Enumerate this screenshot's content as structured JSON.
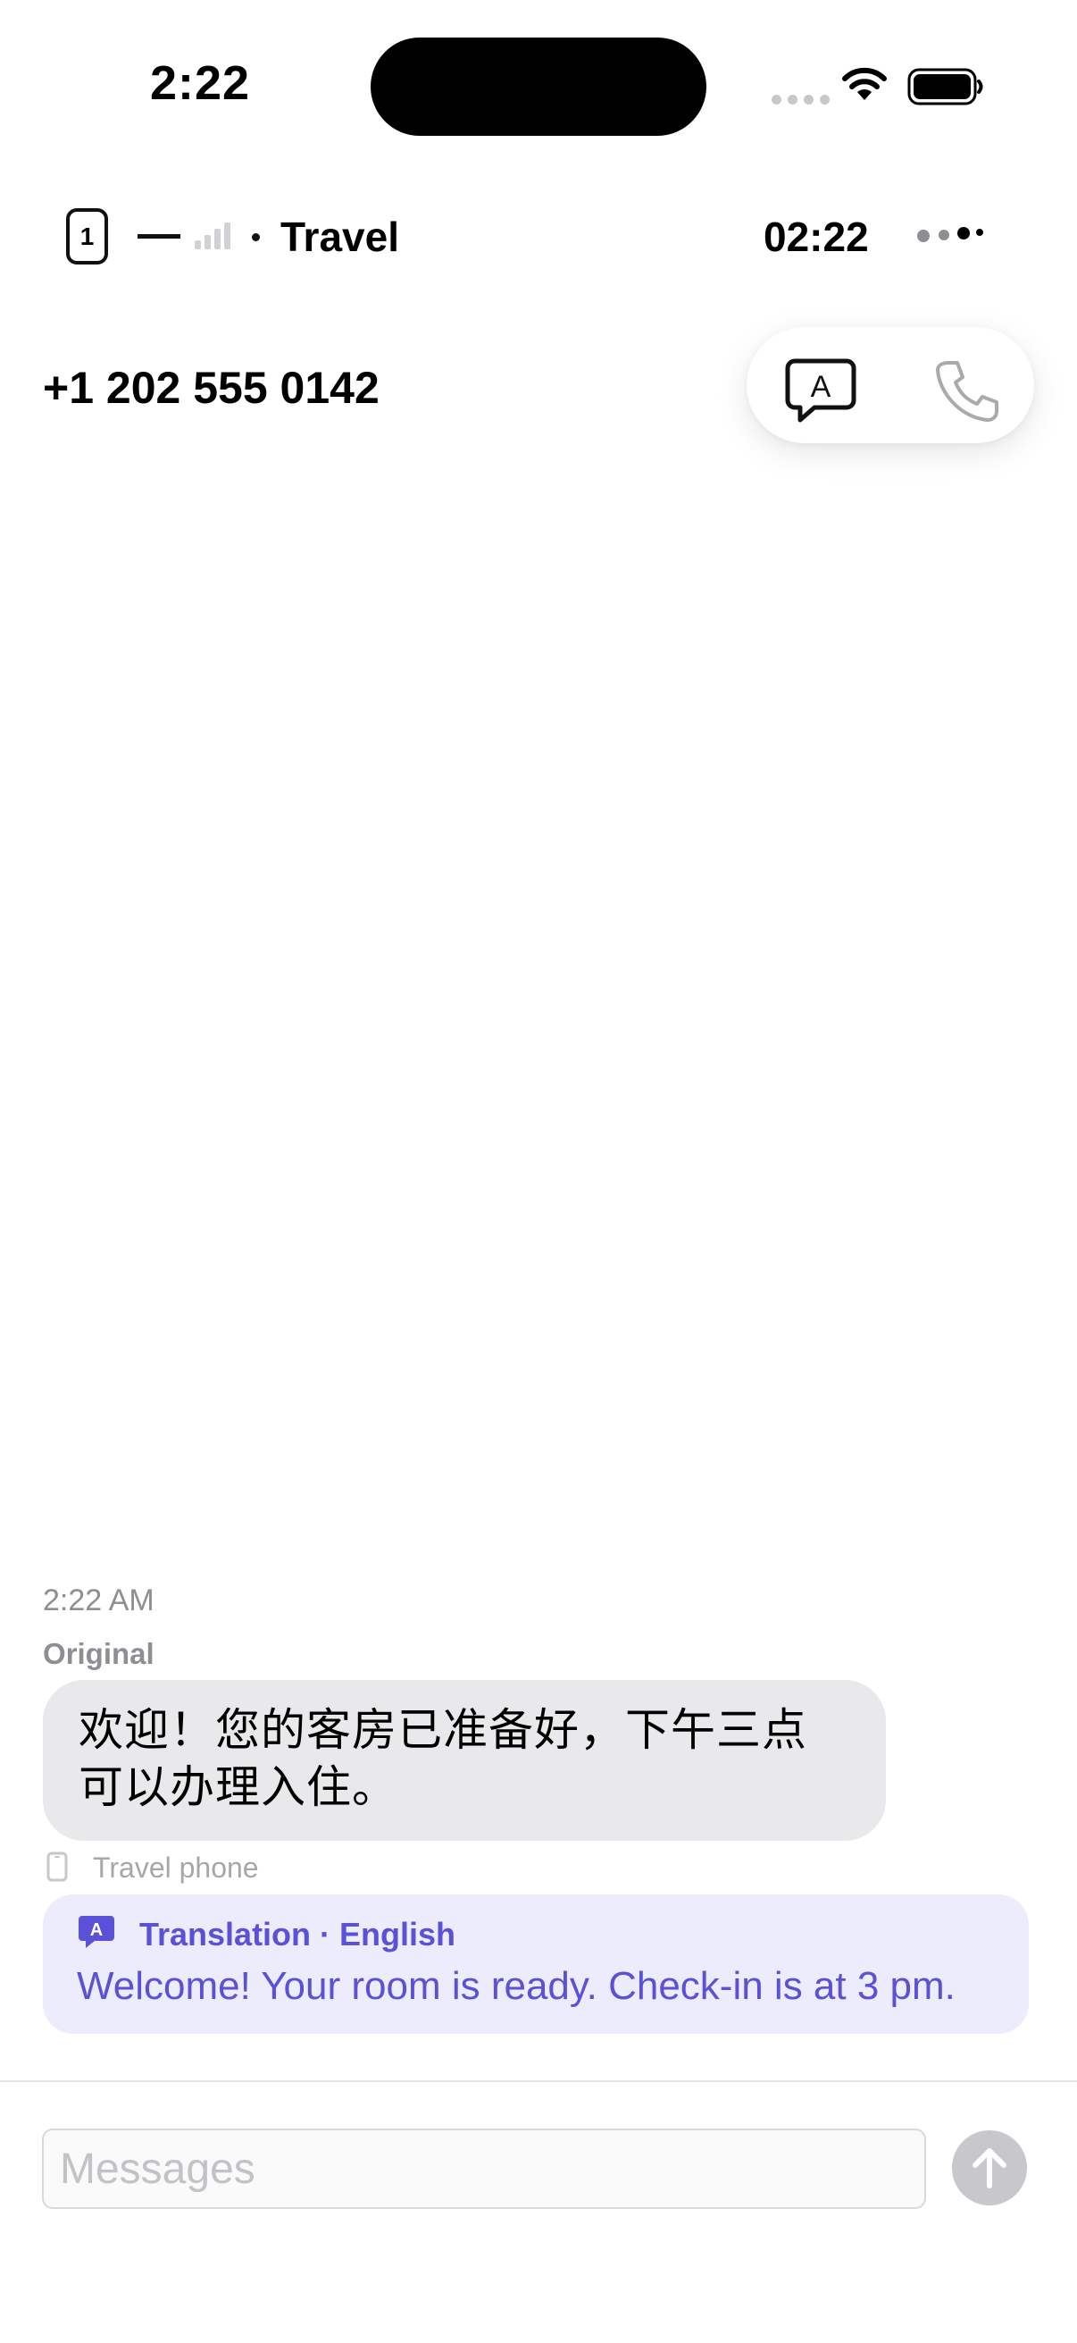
{
  "status_bar": {
    "time": "2:22"
  },
  "line_header": {
    "sim_number": "1",
    "line_name": "Travel",
    "clock": "02:22"
  },
  "contact": {
    "number": "+1 202 555 0142"
  },
  "conversation": {
    "timestamp": "2:22 AM",
    "original_label": "Original",
    "original_text": "欢迎！您的客房已准备好，下午三点可以办理入住。",
    "line_tag": "Travel phone",
    "translation_label": "Translation · English",
    "translation_text": "Welcome! Your room is ready. Check-in is at 3 pm."
  },
  "composer": {
    "placeholder": "Messages"
  },
  "colors": {
    "accent_translation": "#5a51d6",
    "translation_bg": "#ececfc",
    "bubble_bg": "#e9e9eb",
    "muted": "#8e8e93"
  },
  "icons": [
    "wifi-icon",
    "battery-icon",
    "sim-icon",
    "signal-icon",
    "more-icon",
    "translate-icon",
    "phone-icon",
    "device-icon",
    "send-arrow-icon"
  ]
}
